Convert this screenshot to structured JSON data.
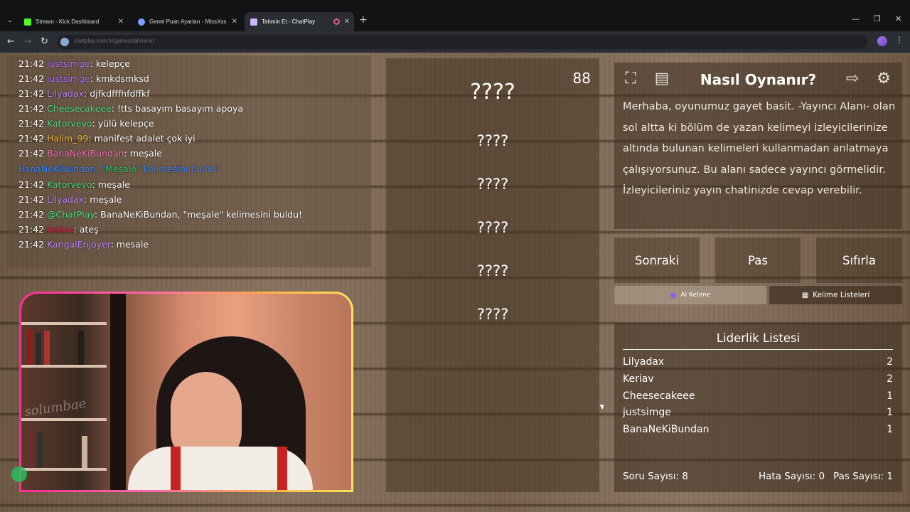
{
  "browser": {
    "tabs": [
      {
        "title": "Stream - Kick Dashboard",
        "icon": "kick-icon",
        "color": "#53fc18"
      },
      {
        "title": "Genel Puan Ayarları - MissXss",
        "icon": "globe-icon",
        "color": "#7aa3ff"
      },
      {
        "title": "Tahmin Et - ChatPlay",
        "icon": "chatplay-icon",
        "color": "#c9b8ff",
        "active": true
      }
    ],
    "new_tab": "+",
    "url": "chatplay.com.tr/games/tahminet"
  },
  "chat": {
    "messages": [
      {
        "time": "21:42",
        "user": "justsimge",
        "color": "#b36bff",
        "text": "kelepçe"
      },
      {
        "time": "21:42",
        "user": "justsimge",
        "color": "#b36bff",
        "text": "kmkdsmksd"
      },
      {
        "time": "21:42",
        "user": "Lilyadax",
        "color": "#c084fc",
        "text": "djfkdfffhfdffkf"
      },
      {
        "time": "21:42",
        "user": "Cheesecakeee",
        "color": "#4ade80",
        "text": "!tts basayım basayım apoya"
      },
      {
        "time": "21:42",
        "user": "Katorvevo",
        "color": "#4ade80",
        "text": "yülü kelepçe"
      },
      {
        "time": "21:42",
        "user": "Halim_99",
        "color": "#f0b43a",
        "text": "manifest adalet çok iyi"
      },
      {
        "time": "21:42",
        "user": "BanaNeKiBundan",
        "color": "#f472b6",
        "text": "meşale"
      },
      {
        "system": true,
        "name": "BanaNeKiBundan",
        "pre": ", \"",
        "word": "Meşale",
        "post": "\" kelimesini buldu!"
      },
      {
        "time": "21:42",
        "user": "Katorvevo",
        "color": "#4ade80",
        "text": "meşale"
      },
      {
        "time": "21:42",
        "user": "Lilyadax",
        "color": "#c084fc",
        "text": "meşale"
      },
      {
        "time": "21:42",
        "user": "@ChatPlay",
        "color": "#4ade80",
        "text": "BanaNeKiBundan, \"meşale\" kelimesini buldu!"
      },
      {
        "time": "21:42",
        "user": "keriav",
        "color": "#e11d48",
        "text": "ateş"
      },
      {
        "time": "21:42",
        "user": "KangalEnjoyer",
        "color": "#c084fc",
        "text": "mesale"
      }
    ]
  },
  "webcam": {
    "watermark": "solumbae"
  },
  "game": {
    "counter": "88",
    "main_word": "????",
    "hints": [
      "????",
      "????",
      "????",
      "????",
      "????"
    ]
  },
  "howto": {
    "title": "Nasıl Oynanır?",
    "text": "Merhaba, oyunumuz gayet basit. -Yayıncı Alanı- olan sol altta ki bölüm de yazan kelimeyi izleyicilerinize altında bulunan kelimeleri kullanmadan anlatmaya çalışıyorsunuz. Bu alanı sadece yayıncı görmelidir. İzleyicileriniz yayın chatinizde cevap verebilir."
  },
  "actions": {
    "next": "Sonraki",
    "pass": "Pas",
    "reset": "Sıfırla"
  },
  "tabs": {
    "ai_word": "AI Kelime",
    "word_lists": "Kelime Listeleri"
  },
  "leaderboard": {
    "title": "Liderlik Listesi",
    "rows": [
      {
        "name": "Lilyadax",
        "score": "2"
      },
      {
        "name": "Keriav",
        "score": "2"
      },
      {
        "name": "Cheesecakeee",
        "score": "1"
      },
      {
        "name": "justsimge",
        "score": "1"
      },
      {
        "name": "BanaNeKiBundan",
        "score": "1"
      }
    ]
  },
  "stats": {
    "questions": "Soru Sayısı: 8",
    "errors": "Hata Sayısı: 0",
    "passes": "Pas Sayısı: 1"
  }
}
